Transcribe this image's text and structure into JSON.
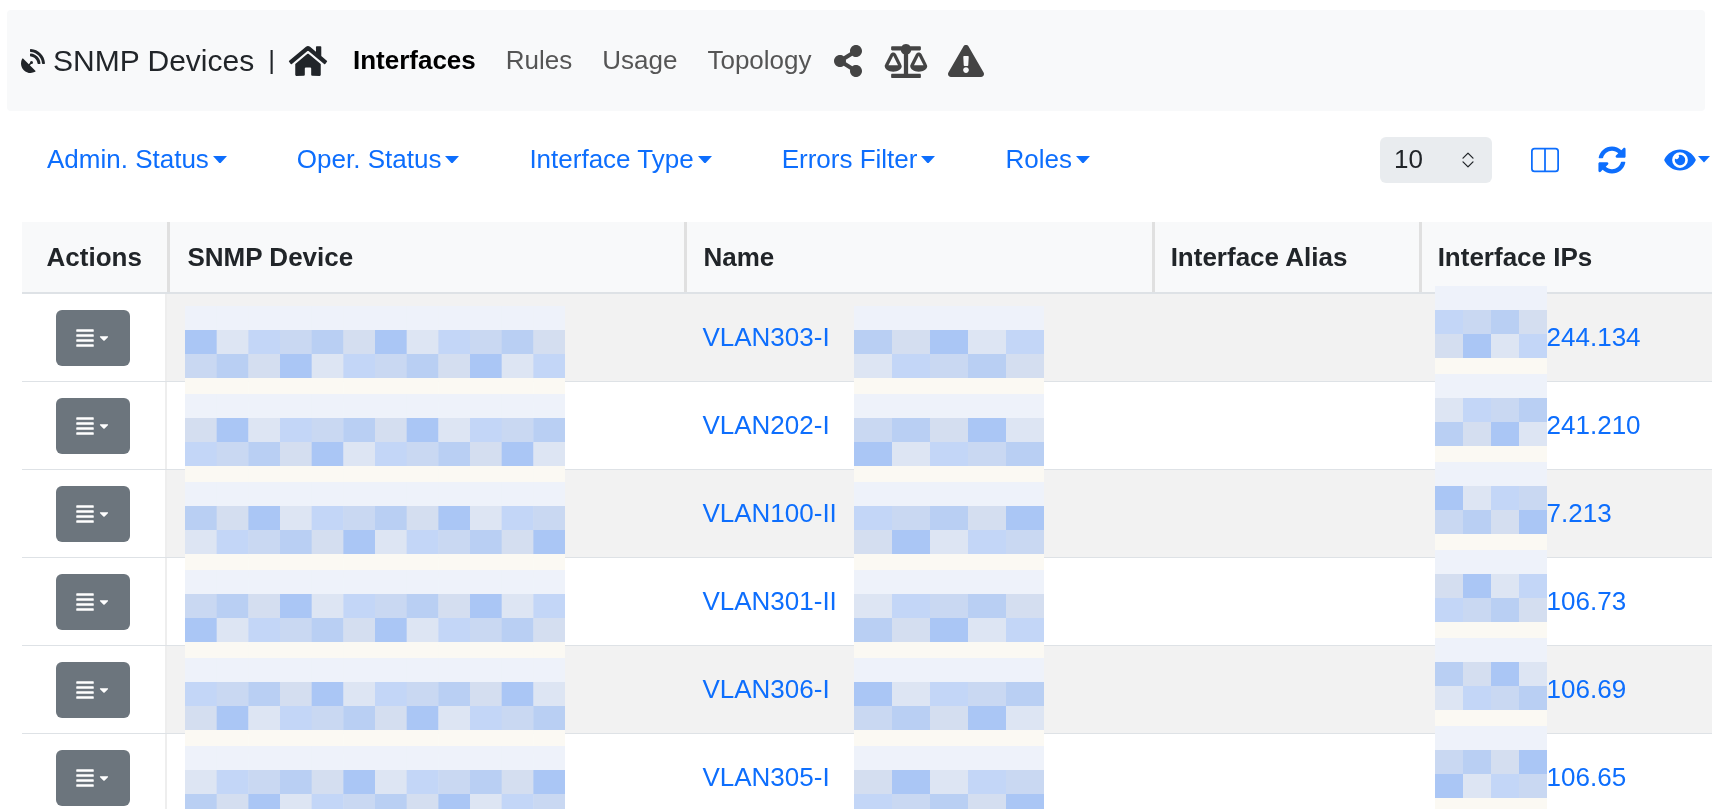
{
  "navbar": {
    "brand": "SNMP Devices",
    "separator": "|",
    "tabs": [
      {
        "label": "Interfaces",
        "selected": true
      },
      {
        "label": "Rules",
        "selected": false
      },
      {
        "label": "Usage",
        "selected": false
      },
      {
        "label": "Topology",
        "selected": false
      }
    ]
  },
  "filters": [
    "Admin. Status",
    "Oper. Status",
    "Interface Type",
    "Errors Filter",
    "Roles"
  ],
  "page_size": "10",
  "table": {
    "columns": [
      "Actions",
      "SNMP Device",
      "Name",
      "Interface Alias",
      "Interface IPs"
    ],
    "rows": [
      {
        "name": "VLAN303-I",
        "ip": "244.134"
      },
      {
        "name": "VLAN202-I",
        "ip": "241.210"
      },
      {
        "name": "VLAN100-II",
        "ip": "7.213"
      },
      {
        "name": "VLAN301-II",
        "ip": "106.73"
      },
      {
        "name": "VLAN306-I",
        "ip": "106.69"
      },
      {
        "name": "VLAN305-I",
        "ip": "106.65"
      }
    ]
  }
}
